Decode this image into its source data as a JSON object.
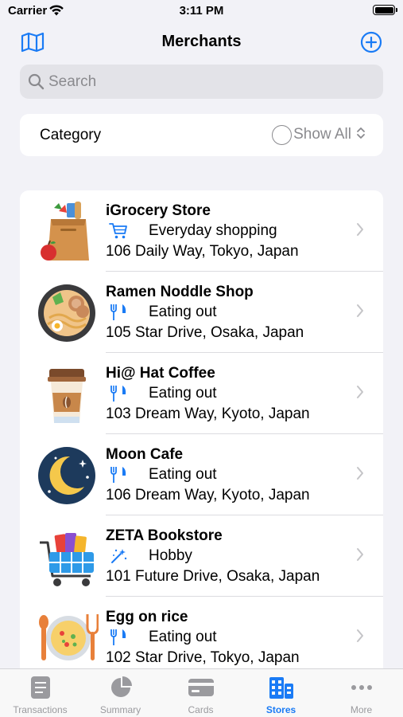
{
  "status_bar": {
    "carrier": "Carrier",
    "time": "3:11 PM"
  },
  "nav": {
    "title": "Merchants",
    "left_icon": "map-icon",
    "right_icon": "plus-circle-icon"
  },
  "search": {
    "placeholder": "Search",
    "value": ""
  },
  "category": {
    "label": "Category",
    "selected": "Show All"
  },
  "merchants": [
    {
      "name": "iGrocery Store",
      "category": "Everyday shopping",
      "category_icon": "cart-icon",
      "address": "106 Daily Way, Tokyo, Japan",
      "image": "grocery-bag-icon"
    },
    {
      "name": "Ramen Noddle Shop",
      "category": "Eating out",
      "category_icon": "fork-knife-icon",
      "address": "105 Star Drive, Osaka, Japan",
      "image": "ramen-bowl-icon"
    },
    {
      "name": "Hi@ Hat Coffee",
      "category": "Eating out",
      "category_icon": "fork-knife-icon",
      "address": "103 Dream Way, Kyoto, Japan",
      "image": "coffee-cup-icon"
    },
    {
      "name": "Moon Cafe",
      "category": "Eating out",
      "category_icon": "fork-knife-icon",
      "address": "106 Dream Way, Kyoto, Japan",
      "image": "moon-icon"
    },
    {
      "name": "ZETA Bookstore",
      "category": "Hobby",
      "category_icon": "magic-wand-icon",
      "address": "101 Future Drive, Osaka, Japan",
      "image": "shopping-cart-books-icon"
    },
    {
      "name": "Egg on rice",
      "category": "Eating out",
      "category_icon": "fork-knife-icon",
      "address": "102 Star Drive, Tokyo, Japan",
      "image": "egg-rice-plate-icon"
    }
  ],
  "tabs": [
    {
      "label": "Transactions",
      "icon": "list-icon",
      "active": false
    },
    {
      "label": "Summary",
      "icon": "pie-chart-icon",
      "active": false
    },
    {
      "label": "Cards",
      "icon": "card-icon",
      "active": false
    },
    {
      "label": "Stores",
      "icon": "building-icon",
      "active": true
    },
    {
      "label": "More",
      "icon": "ellipsis-icon",
      "active": false
    }
  ],
  "colors": {
    "accent": "#1a7bf5",
    "background": "#f2f2f7",
    "inactive_tab": "#9a9a9e"
  }
}
